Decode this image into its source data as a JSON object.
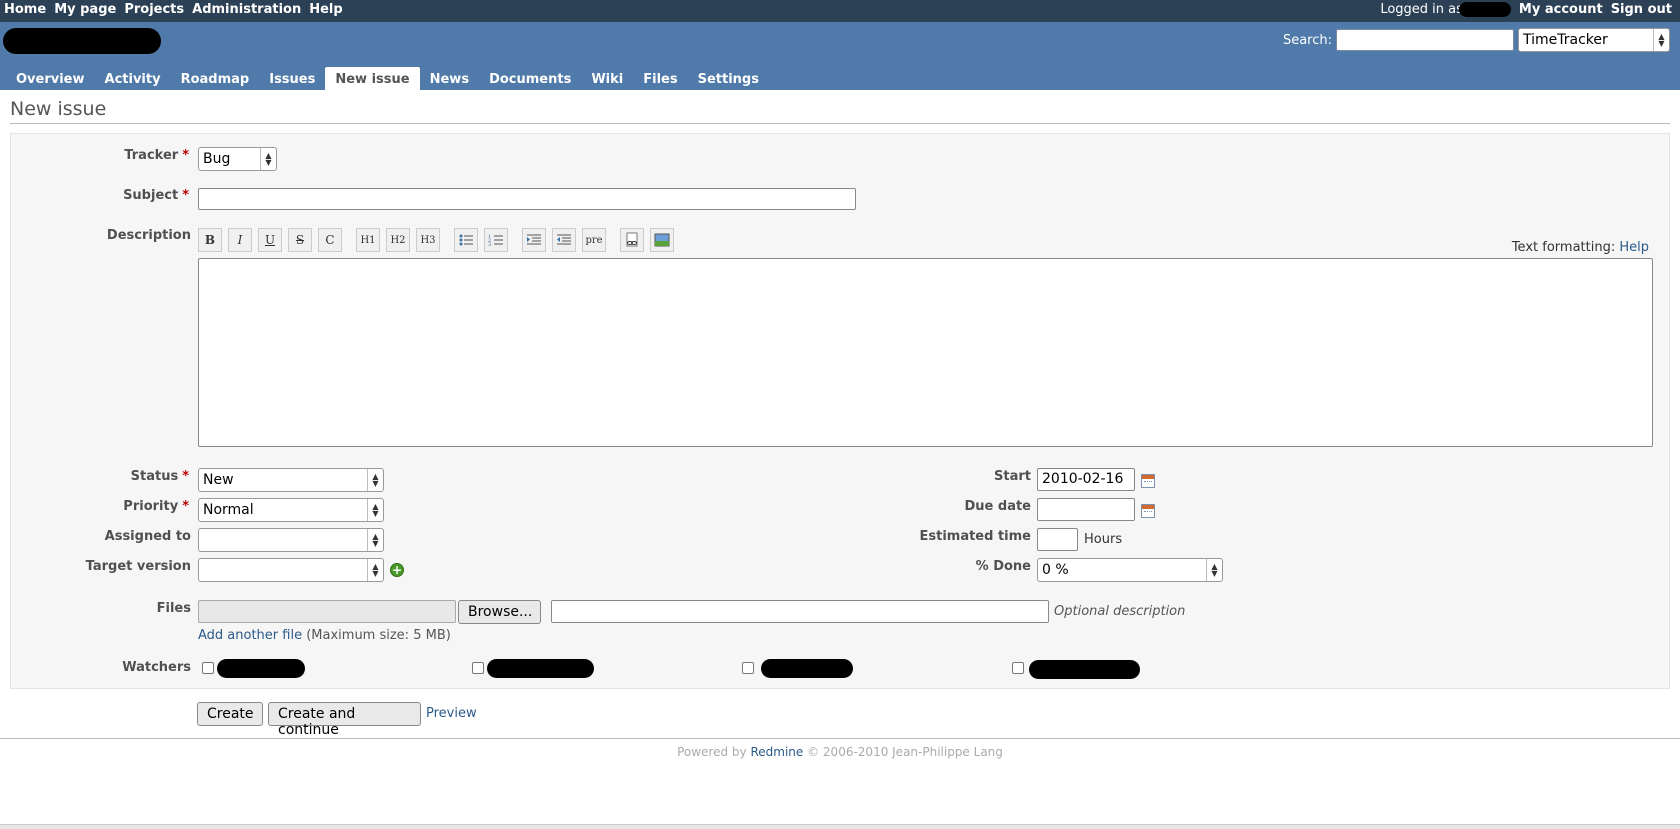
{
  "top_menu": {
    "left": [
      "Home",
      "My page",
      "Projects",
      "Administration",
      "Help"
    ],
    "logged_in_prefix": "Logged in as",
    "my_account": "My account",
    "sign_out": "Sign out"
  },
  "header": {
    "search_label": "Search:",
    "search_value": "",
    "project_selected": "TimeTracker"
  },
  "main_menu": [
    {
      "label": "Overview",
      "selected": false
    },
    {
      "label": "Activity",
      "selected": false
    },
    {
      "label": "Roadmap",
      "selected": false
    },
    {
      "label": "Issues",
      "selected": false
    },
    {
      "label": "New issue",
      "selected": true
    },
    {
      "label": "News",
      "selected": false
    },
    {
      "label": "Documents",
      "selected": false
    },
    {
      "label": "Wiki",
      "selected": false
    },
    {
      "label": "Files",
      "selected": false
    },
    {
      "label": "Settings",
      "selected": false
    }
  ],
  "page_title": "New issue",
  "form": {
    "tracker_label": "Tracker",
    "tracker_value": "Bug",
    "subject_label": "Subject",
    "subject_value": "",
    "description_label": "Description",
    "toolbar": [
      "B",
      "I",
      "U",
      "S",
      "C",
      "H1",
      "H2",
      "H3",
      "ul",
      "ol",
      "indent",
      "outdent",
      "pre",
      "link",
      "image"
    ],
    "text_formatting": "Text formatting:",
    "help": "Help",
    "required_mark": "*",
    "status_label": "Status",
    "status_value": "New",
    "priority_label": "Priority",
    "priority_value": "Normal",
    "assigned_label": "Assigned to",
    "assigned_value": "",
    "target_label": "Target version",
    "target_value": "",
    "start_label": "Start",
    "start_value": "2010-02-16",
    "due_label": "Due date",
    "due_value": "",
    "estimated_label": "Estimated time",
    "estimated_value": "",
    "hours": "Hours",
    "done_label": "% Done",
    "done_value": "0 %",
    "files_label": "Files",
    "browse": "Browse...",
    "optional_desc": "Optional description",
    "add_file": "Add another file",
    "max_size": "(Maximum size: 5 MB)",
    "watchers_label": "Watchers"
  },
  "actions": {
    "create": "Create",
    "create_continue": "Create and continue",
    "preview": "Preview"
  },
  "footer": {
    "powered": "Powered by",
    "redmine": "Redmine",
    "copyright": "© 2006-2010 Jean-Philippe Lang"
  }
}
